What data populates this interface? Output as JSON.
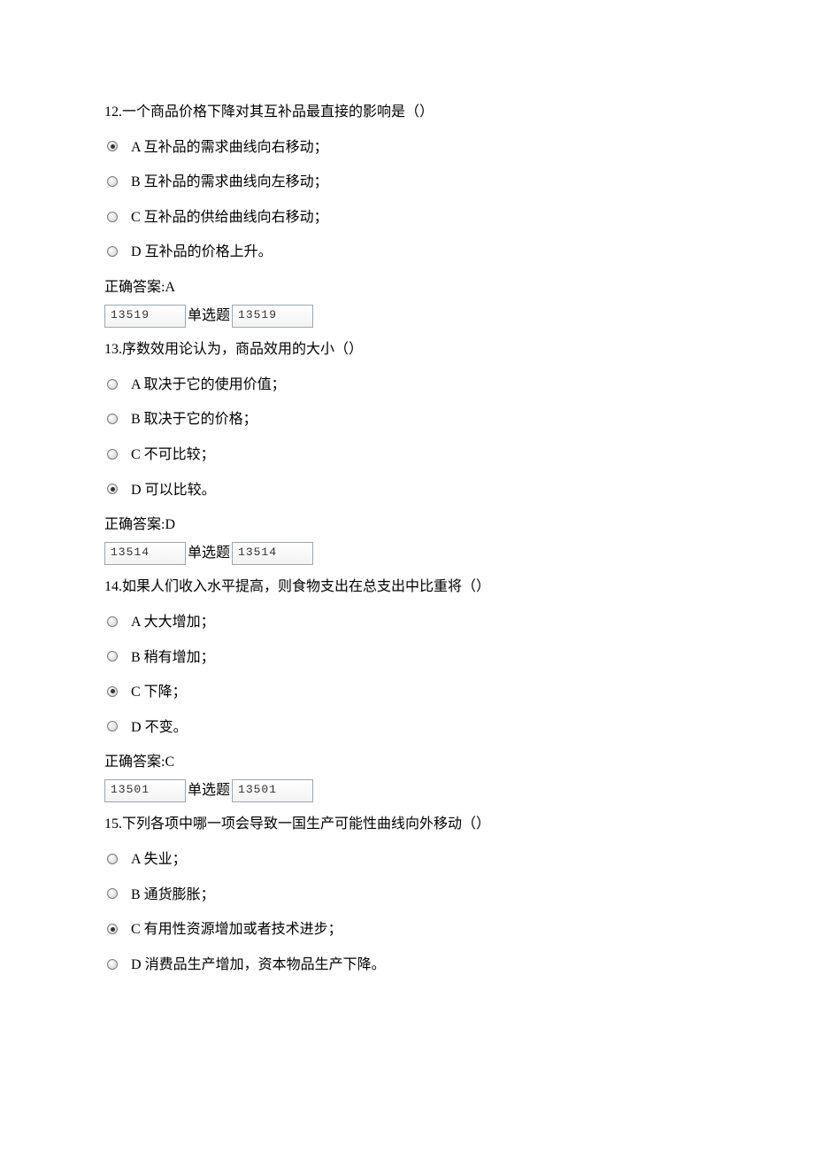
{
  "questions": [
    {
      "num": "12.",
      "text": "一个商品价格下降对其互补品最直接的影响是（）",
      "options": [
        {
          "letter": "A",
          "text": "互补品的需求曲线向右移动；",
          "selected": true
        },
        {
          "letter": "B",
          "text": "互补品的需求曲线向左移动；",
          "selected": false
        },
        {
          "letter": "C",
          "text": "互补品的供给曲线向右移动；",
          "selected": false
        },
        {
          "letter": "D",
          "text": "互补品的价格上升。",
          "selected": false
        }
      ],
      "answer_label": "正确答案:",
      "answer": "A",
      "id1": "13519",
      "type_label": "单选题",
      "id2": "13519"
    },
    {
      "num": "13.",
      "text": "序数效用论认为，商品效用的大小（）",
      "options": [
        {
          "letter": "A",
          "text": "取决于它的使用价值；",
          "selected": false
        },
        {
          "letter": "B",
          "text": "取决于它的价格；",
          "selected": false
        },
        {
          "letter": "C",
          "text": "不可比较；",
          "selected": false
        },
        {
          "letter": "D",
          "text": "可以比较。",
          "selected": true
        }
      ],
      "answer_label": "正确答案:",
      "answer": "D",
      "id1": "13514",
      "type_label": "单选题",
      "id2": "13514"
    },
    {
      "num": "14.",
      "text": "如果人们收入水平提高，则食物支出在总支出中比重将（）",
      "options": [
        {
          "letter": "A",
          "text": "大大增加；",
          "selected": false
        },
        {
          "letter": "B",
          "text": "稍有增加；",
          "selected": false
        },
        {
          "letter": "C",
          "text": "下降；",
          "selected": true
        },
        {
          "letter": "D",
          "text": "不变。",
          "selected": false
        }
      ],
      "answer_label": "正确答案:",
      "answer": "C",
      "id1": "13501",
      "type_label": "单选题",
      "id2": "13501"
    },
    {
      "num": "15.",
      "text": "下列各项中哪一项会导致一国生产可能性曲线向外移动（）",
      "options": [
        {
          "letter": "A",
          "text": "失业；",
          "selected": false
        },
        {
          "letter": "B",
          "text": "通货膨胀；",
          "selected": false
        },
        {
          "letter": "C",
          "text": "有用性资源增加或者技术进步；",
          "selected": true
        },
        {
          "letter": "D",
          "text": "消费品生产增加，资本物品生产下降。",
          "selected": false
        }
      ],
      "answer_label": "",
      "answer": "",
      "id1": "",
      "type_label": "",
      "id2": ""
    }
  ]
}
